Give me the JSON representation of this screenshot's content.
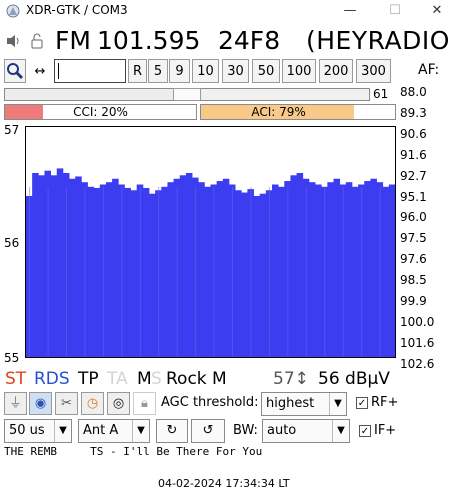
{
  "window": {
    "title": "XDR-GTK / COM3",
    "min": "—",
    "max": "☐",
    "close": "✕"
  },
  "station": {
    "band": "FM",
    "frequency": "101.595",
    "pi": "24F8",
    "ps": "(HEYRADIO"
  },
  "toolbar": {
    "input_value": "",
    "steps": [
      "R",
      "5",
      "9",
      "10",
      "30",
      "50",
      "100",
      "200",
      "300"
    ],
    "af_label": "AF:"
  },
  "af_list": [
    "88.0",
    "89.3",
    "90.6",
    "91.6",
    "92.7",
    "95.1",
    "96.0",
    "97.5",
    "97.6",
    "98.5",
    "99.9",
    "100.0",
    "101.6",
    "102.6"
  ],
  "signal": {
    "slider_value": "61",
    "slider_fraction": 0.5
  },
  "interference": {
    "cci_label": "CCI: 20%",
    "cci": 0.2,
    "aci_label": "ACI: 79%",
    "aci": 0.79,
    "cci_color": "#ef7c7c",
    "aci_color": "#f9c98a"
  },
  "chart_data": {
    "type": "area",
    "y_ticks": [
      "57",
      "56",
      "55"
    ],
    "ylim": [
      55,
      57
    ],
    "color": "#3c3cf0",
    "values": [
      56.4,
      56.6,
      56.58,
      56.62,
      56.58,
      56.64,
      56.6,
      56.55,
      56.57,
      56.52,
      56.48,
      56.47,
      56.5,
      56.52,
      56.55,
      56.5,
      56.47,
      56.45,
      56.5,
      56.47,
      56.42,
      56.45,
      56.48,
      56.52,
      56.55,
      56.58,
      56.6,
      56.56,
      56.52,
      56.48,
      56.5,
      56.53,
      56.55,
      56.5,
      56.45,
      56.43,
      56.46,
      56.4,
      56.42,
      56.45,
      56.5,
      56.48,
      56.53,
      56.58,
      56.6,
      56.55,
      56.52,
      56.5,
      56.48,
      56.52,
      56.55,
      56.5,
      56.52,
      56.48,
      56.5,
      56.53,
      56.55,
      56.52,
      56.48,
      56.5
    ]
  },
  "rds_flags": {
    "st": "ST",
    "rds": "RDS",
    "tp": "TP",
    "ta": "TA",
    "ms_m": "M",
    "ms_s": "S",
    "pty": "Rock M",
    "signal_peak": "57↕",
    "signal_value": "56 dBµV"
  },
  "controls": {
    "agc_label": "AGC threshold:",
    "agc_value": "highest",
    "rf_label": "RF+",
    "rf_checked": "✓",
    "deemphasis": "50 us",
    "antenna": "Ant A",
    "bw_label": "BW:",
    "bw_value": "auto",
    "if_label": "IF+",
    "if_checked": "✓"
  },
  "radiotext": {
    "line1": "THE REMB     TS - I'll Be There For You"
  },
  "status": {
    "time": "04-02-2024 17:34:34 LT"
  }
}
